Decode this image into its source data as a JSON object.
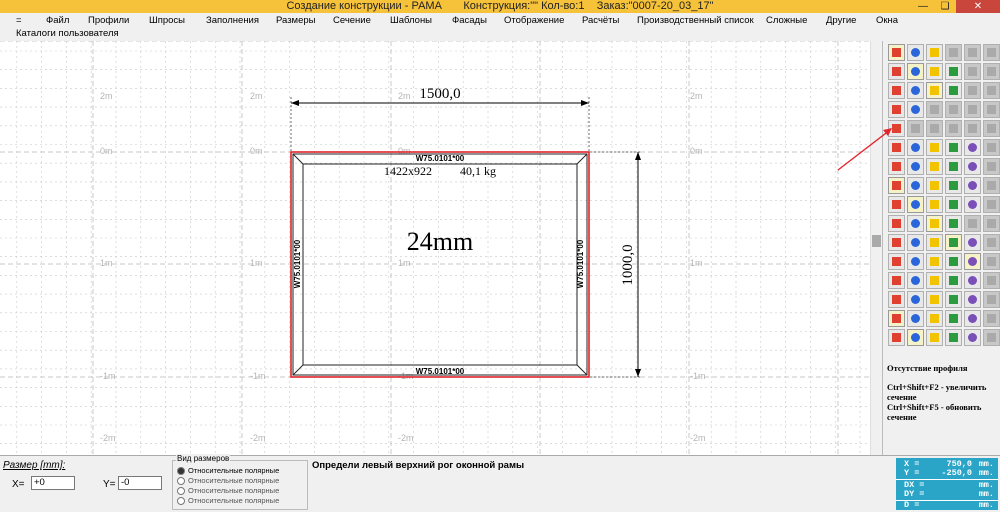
{
  "window": {
    "title": "Создание конструкции - РАМА",
    "construction": "Конструкция:\"\" Кол-во:1",
    "order": "Заказ:\"0007-20_03_17\""
  },
  "menu": {
    "row1": [
      "=",
      "Файл",
      "Профили",
      "Шпросы",
      "Заполнения",
      "Размеры",
      "Сечение",
      "Шаблоны",
      "Фасады",
      "Отображение",
      "Расчёты",
      "Производственный список",
      "Сложные",
      "Другие",
      "Окна"
    ],
    "row2": [
      "Каталоги пользователя"
    ]
  },
  "drawing": {
    "width_dim": "1500,0",
    "height_dim": "1000,0",
    "size_info": "1422x922",
    "weight": "40,1 kg",
    "fill": "24mm",
    "profile_top": "W75.0101*00",
    "profile_bottom": "W75.0101*00",
    "profile_left": "W75.0101*00",
    "profile_right": "W75.0101*00",
    "grid_labels": [
      "0m",
      "0m",
      "0m",
      "0m",
      "1m",
      "1m",
      "1m",
      "1m",
      "-1m",
      "-1m",
      "-1m",
      "-1m",
      "2m",
      "2m",
      "2m",
      "2m",
      "-2m",
      "-2m",
      "-2m",
      "-2m"
    ],
    "grid_small": "500mm",
    "colors": {
      "frame": "#e3242b",
      "profile": "#222222",
      "grid": "#c8c8c8"
    }
  },
  "tools": {
    "icons": [
      "pencil-icon",
      "measure-icon",
      "arc-icon",
      "ghost-icon",
      "ghost-icon",
      "ghost-icon",
      "frame-icon",
      "frame-split-icon",
      "profile-icon",
      "profile-red-icon",
      "ghost-icon",
      "ghost-icon",
      "arrow-up-icon",
      "arc-grid-icon",
      "grid-icon",
      "calc-icon",
      "ghost-icon",
      "ghost-icon",
      "delete-icon",
      "impost-icon",
      "ghost-icon",
      "ghost-icon",
      "ghost-icon",
      "ghost-icon",
      "sash-icon",
      "ghost-icon",
      "ghost-icon",
      "ghost-icon",
      "ghost-icon",
      "ghost-icon",
      "vertical-icon",
      "mirror-icon",
      "expand-icon",
      "h-tool-icon",
      "x-tool-icon",
      "ghost-icon",
      "square-icon",
      "square2-icon",
      "numbers-icon",
      "numbers-red-icon",
      "blue-tool-icon",
      "ghost-icon",
      "shape-icon",
      "shape2-icon",
      "shape3-icon",
      "shape4-icon",
      "shape5-icon",
      "ghost-icon",
      "shape-icon",
      "shape2-icon",
      "shape3-icon",
      "shape4-icon",
      "shape5-icon",
      "ghost-icon",
      "paint-icon",
      "shape6-icon",
      "dxf-icon",
      "dxf2-icon",
      "ghost-icon",
      "ghost-icon",
      "zoom-out-icon",
      "zoom-in-icon",
      "zoom-fit-icon",
      "globe-icon",
      "undo-icon",
      "ghost-icon",
      "cross-icon",
      "color-wheel-icon",
      "chart-icon",
      "pen-icon",
      "check-icon",
      "ghost-icon",
      "cards-icon",
      "bookmark-icon",
      "copy-icon",
      "cross-red-icon",
      "question-icon",
      "ghost-icon",
      "grid-yellow-icon",
      "grid2-icon",
      "door-icon",
      "shutter-icon",
      "frame-yellow-icon",
      "ghost-icon",
      "xyz-icon",
      "xyz2-icon",
      "scn-icon",
      "panel-icon",
      "stairs-icon",
      "ghost-icon",
      "grid3-icon",
      "grid-red-icon",
      "arch-icon",
      "arch2-icon",
      "fill-yellow-icon",
      "ghost-icon"
    ],
    "hint_title": "Отсутствие профиля",
    "hint_line1": "Ctrl+Shift+F2 - увеличить сечение",
    "hint_line2": "Ctrl+Shift+F5 - обновить сечение"
  },
  "bottom": {
    "size_label": "Размер [mm]:",
    "x_label": "X=",
    "x_value": "+0",
    "y_label": "Y=",
    "y_value": "-0",
    "group_caption": "Вид размеров",
    "radio1": "Относительные полярные",
    "radio2": "Относительные полярные",
    "radio3": "Относительные полярные",
    "radio4": "Относительные полярные",
    "message": "Определи левый верхний рог оконной рамы"
  },
  "coords": {
    "x_key": "X =",
    "x_val": "750,0",
    "x_unit": "mm.",
    "y_key": "Y =",
    "y_val": "-250,0",
    "y_unit": "mm.",
    "dx_key": "DX =",
    "dx_val": "",
    "dx_unit": "mm.",
    "dy_key": "DY =",
    "dy_val": "",
    "dy_unit": "mm.",
    "d_key": "D =",
    "d_val": "",
    "d_unit": "mm."
  }
}
